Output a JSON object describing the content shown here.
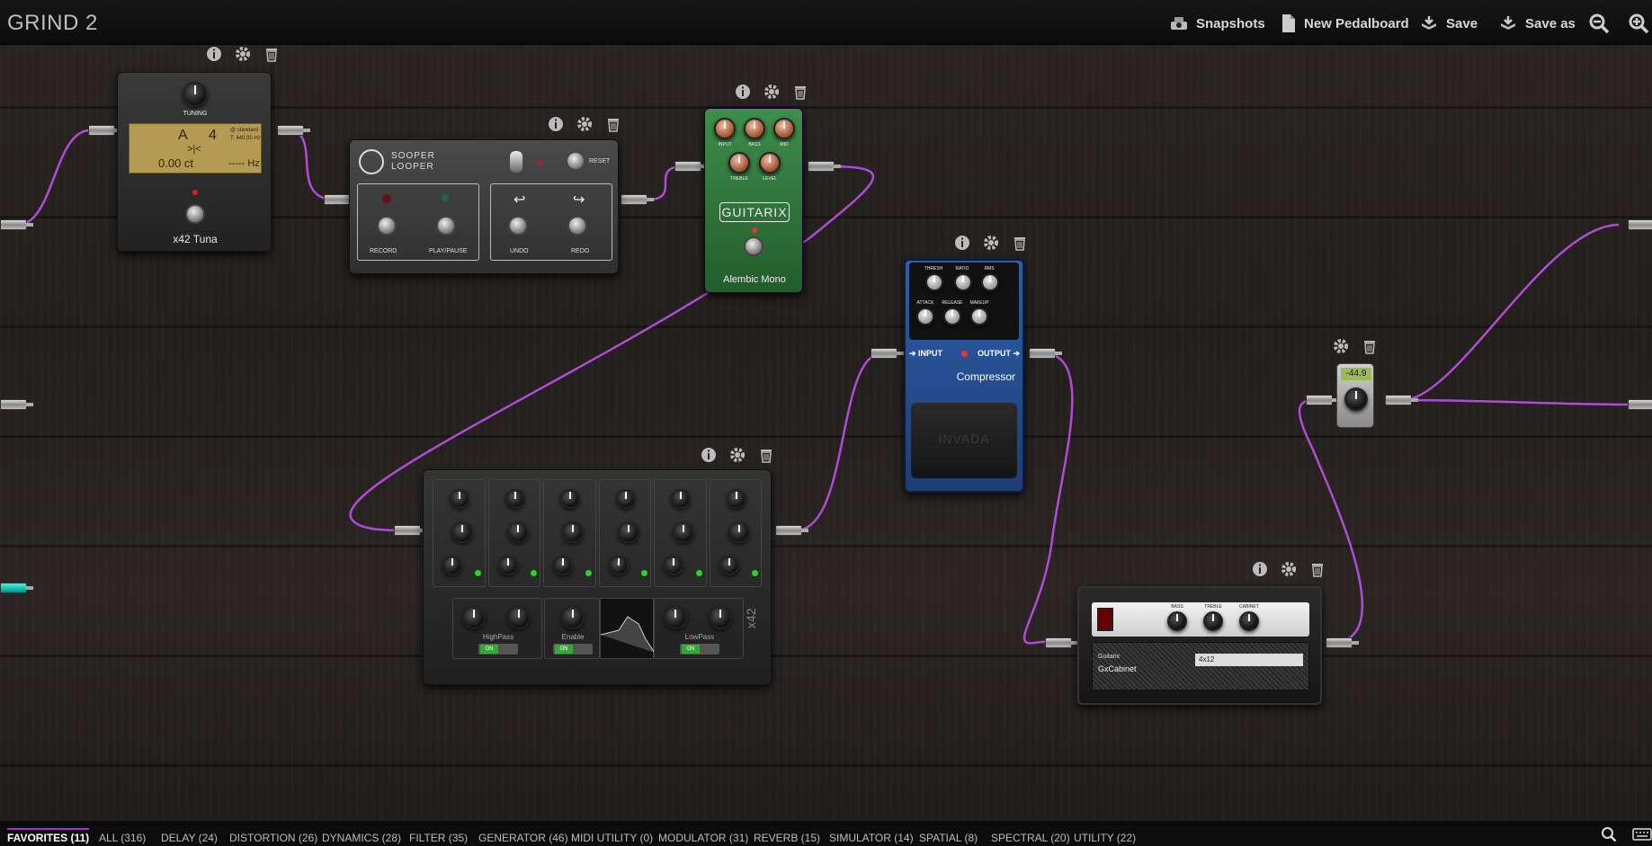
{
  "header": {
    "title": "GRIND 2",
    "buttons": {
      "snapshots": "Snapshots",
      "new_pedalboard": "New Pedalboard",
      "save": "Save",
      "save_as": "Save as"
    }
  },
  "colors": {
    "cable": "#b24ad8",
    "accent": "#a62bdc"
  },
  "plugins": {
    "tuner": {
      "knob_label": "TUNING",
      "note": "A",
      "octave": "4",
      "standard": "@ standard",
      "freq_ref": "T: 440.00 Hz",
      "marker": ">|<",
      "cents": "0.00 ct",
      "hz": "----- Hz",
      "name": "x42 Tuna"
    },
    "looper": {
      "brand_line1": "SOOPER",
      "brand_line2": "LOOPER",
      "reset": "RESET",
      "record": "RECORD",
      "play_pause": "PLAY/PAUSE",
      "undo": "UNDO",
      "redo": "REDO"
    },
    "guitarix": {
      "knobs": [
        "INPUT",
        "BASS",
        "MID",
        "TREBLE",
        "LEVEL"
      ],
      "brand": "GUITARIX",
      "name": "Alembic Mono"
    },
    "compressor": {
      "knobs_top": [
        "THRESH",
        "RATIO",
        "RMS"
      ],
      "knobs_bottom": [
        "ATTACK",
        "RELEASE",
        "MAKEUP"
      ],
      "input": "INPUT",
      "output": "OUTPUT",
      "name": "Compressor",
      "brand": "INVADA"
    },
    "eq": {
      "highpass": "HighPass",
      "enable": "Enable",
      "lowpass": "LowPass",
      "on": "ON",
      "brand": "x42"
    },
    "gain": {
      "value": "-44.9"
    },
    "cabinet": {
      "knobs": [
        "BASS",
        "TREBLE",
        "CABINET"
      ],
      "brand": "Guitarix",
      "name": "GxCabinet",
      "model": "4x12"
    }
  },
  "categories": [
    "FAVORITES (11)",
    "ALL (316)",
    "DELAY (24)",
    "DISTORTION (26)",
    "DYNAMICS (28)",
    "FILTER (35)",
    "GENERATOR (46)",
    "MIDI UTILITY (0)",
    "MODULATOR (31)",
    "REVERB (15)",
    "SIMULATOR (14)",
    "SPATIAL (8)",
    "SPECTRAL (20)",
    "UTILITY (22)"
  ],
  "active_category": "FAVORITES (11)"
}
